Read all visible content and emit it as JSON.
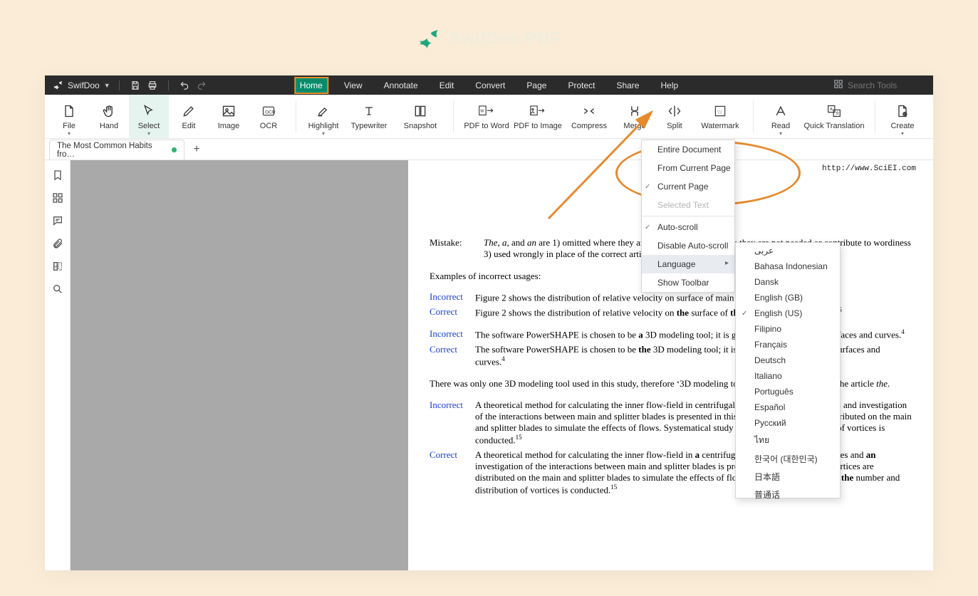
{
  "brand": {
    "name": "SwifDoo PDF"
  },
  "titlebar": {
    "appname": "SwifDoo",
    "search_placeholder": "Search Tools"
  },
  "menutabs": [
    {
      "label": "Home",
      "active": true
    },
    {
      "label": "View"
    },
    {
      "label": "Annotate"
    },
    {
      "label": "Edit"
    },
    {
      "label": "Convert"
    },
    {
      "label": "Page"
    },
    {
      "label": "Protect"
    },
    {
      "label": "Share"
    },
    {
      "label": "Help"
    }
  ],
  "ribbon": [
    {
      "id": "file",
      "label": "File",
      "dd": true
    },
    {
      "id": "hand",
      "label": "Hand"
    },
    {
      "id": "select",
      "label": "Select",
      "selected": true,
      "dd": true
    },
    {
      "id": "edit",
      "label": "Edit"
    },
    {
      "id": "image",
      "label": "Image"
    },
    {
      "id": "ocr",
      "label": "OCR"
    },
    {
      "sep": true
    },
    {
      "id": "highlight",
      "label": "Highlight",
      "dd": true
    },
    {
      "id": "typewriter",
      "label": "Typewriter",
      "wide": true
    },
    {
      "id": "snapshot",
      "label": "Snapshot",
      "wide": true
    },
    {
      "sep": true
    },
    {
      "id": "pdf2word",
      "label": "PDF to Word",
      "wide": true
    },
    {
      "id": "pdf2img",
      "label": "PDF to Image",
      "wide": true
    },
    {
      "id": "compress",
      "label": "Compress",
      "wide": true
    },
    {
      "id": "merge",
      "label": "Merge"
    },
    {
      "id": "split",
      "label": "Split"
    },
    {
      "id": "watermark",
      "label": "Watermark",
      "wide": true
    },
    {
      "sep": true
    },
    {
      "id": "read",
      "label": "Read",
      "dd": true
    },
    {
      "id": "qtrans",
      "label": "Quick Translation",
      "wider": true
    },
    {
      "sep": true
    },
    {
      "id": "create",
      "label": "Create",
      "dd": true
    }
  ],
  "tabstrip": {
    "doc_title": "The Most Common Habits fro…",
    "modified": true
  },
  "leftrail_icons": [
    "bookmark",
    "thumbnails",
    "comments",
    "attachments",
    "compare",
    "search"
  ],
  "read_menu": {
    "items": [
      {
        "label": "Entire Document"
      },
      {
        "label": "From Current Page"
      },
      {
        "label": "Current Page",
        "checked": true
      },
      {
        "label": "Selected Text",
        "disabled": true
      },
      {
        "hr": true
      },
      {
        "label": "Auto-scroll",
        "checked": true
      },
      {
        "label": "Disable Auto-scroll"
      },
      {
        "label": "Language",
        "submenu": true,
        "selected": true
      },
      {
        "label": "Show Toolbar"
      }
    ]
  },
  "language_menu": [
    {
      "label": "عربى"
    },
    {
      "label": "Bahasa Indonesian"
    },
    {
      "label": "Dansk"
    },
    {
      "label": "English (GB)"
    },
    {
      "label": "English (US)",
      "checked": true
    },
    {
      "label": "Filipino"
    },
    {
      "label": "Français"
    },
    {
      "label": "Deutsch"
    },
    {
      "label": "Italiano"
    },
    {
      "label": "Português"
    },
    {
      "label": "Español"
    },
    {
      "label": "Русский"
    },
    {
      "label": "ไทย"
    },
    {
      "label": "한국어 (대한민국)"
    },
    {
      "label": "日本語"
    },
    {
      "label": "普通话"
    }
  ],
  "document": {
    "header_url": "http://www.SciEI.com",
    "mistake_label": "Mistake:",
    "mistake_html": "<span class='ital'>The</span>, <span class='ital'>a</span>, and <span class='ital'>an</span> are 1) omitted where they are required, 2) used where they are not needed or contribute to wordiness 3) used wrongly in place of the correct article.",
    "examples_heading": "Examples of incorrect usages:",
    "pairs": [
      {
        "incorrect": "Figure 2 shows the distribution of relative velocity on surface of main and splitter blades.<span class='sup'>15</span>",
        "correct": "Figure 2 shows the distribution of relative velocity on <b>the</b> surface of <b>the</b> main and splitter blades.<span class='sup'>15</span>"
      },
      {
        "incorrect": "The software PowerSHAPE is chosen to be <b>a</b> 3D modeling tool; it is good at dealing with free surfaces and curves.<span class='sup'>4</span>",
        "correct": "The software PowerSHAPE is chosen to be <b>the</b> 3D modeling tool; it is good at dealing with free surfaces and curves.<span class='sup'>4</span>"
      }
    ],
    "between_note": "There was only one 3D modeling tool used in this study, therefore ‘3D modeling tool’ is specific and requires the article <span class='ital'>the</span>.",
    "pair3": {
      "incorrect": "A theoretical method for calculating the inner flow-field in centrifugal impeller with splitter blades and investigation of the interactions between main and splitter blades is presented in this paper. The vortices are distributed on the main and splitter blades to simulate the effects of flows. Systematical study of number and distribution of vortices is conducted.<span class='sup'>15</span>",
      "correct": "A theoretical method for calculating the inner flow-field in <b>a</b> centrifugal impeller with splitter blades and <b>an</b> investigation of the interactions between main and splitter blades is presented in this paper. The vortices are distributed on the main and splitter blades to simulate the effects of flows. <b>A</b> systematical study of <b>the</b> number and distribution of vortices is conducted.<span class='sup'>15</span>"
    },
    "labels": {
      "incorrect": "Incorrect",
      "correct": "Correct"
    }
  }
}
